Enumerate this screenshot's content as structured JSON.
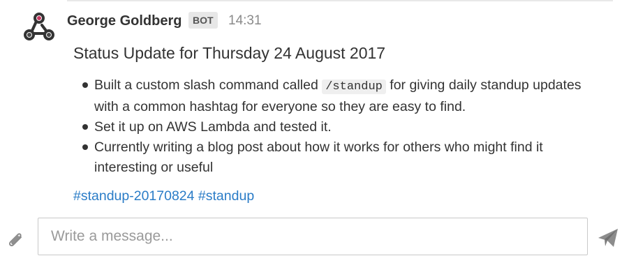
{
  "message": {
    "author": "George Goldberg",
    "badge": "BOT",
    "time": "14:31",
    "title": "Status Update for Thursday 24 August 2017",
    "bullets": {
      "b1_before": "Built a custom slash command called ",
      "b1_code": "/standup",
      "b1_after": " for giving daily standup updates with a common hashtag for everyone so they are easy to find.",
      "b2": "Set it up on AWS Lambda and tested it.",
      "b3": "Currently writing a blog post about how it works for others who might find it interesting or useful"
    },
    "hashtags": [
      "#standup-20170824",
      "#standup"
    ]
  },
  "composer": {
    "placeholder": "Write a message..."
  },
  "icons": {
    "avatar": "webhook-logo-icon",
    "attach": "paperclip-icon",
    "send": "paper-plane-icon"
  },
  "colors": {
    "link": "#2a7cc7",
    "badge_bg": "#e7e7e7",
    "timestamp": "#8a8a8a"
  }
}
